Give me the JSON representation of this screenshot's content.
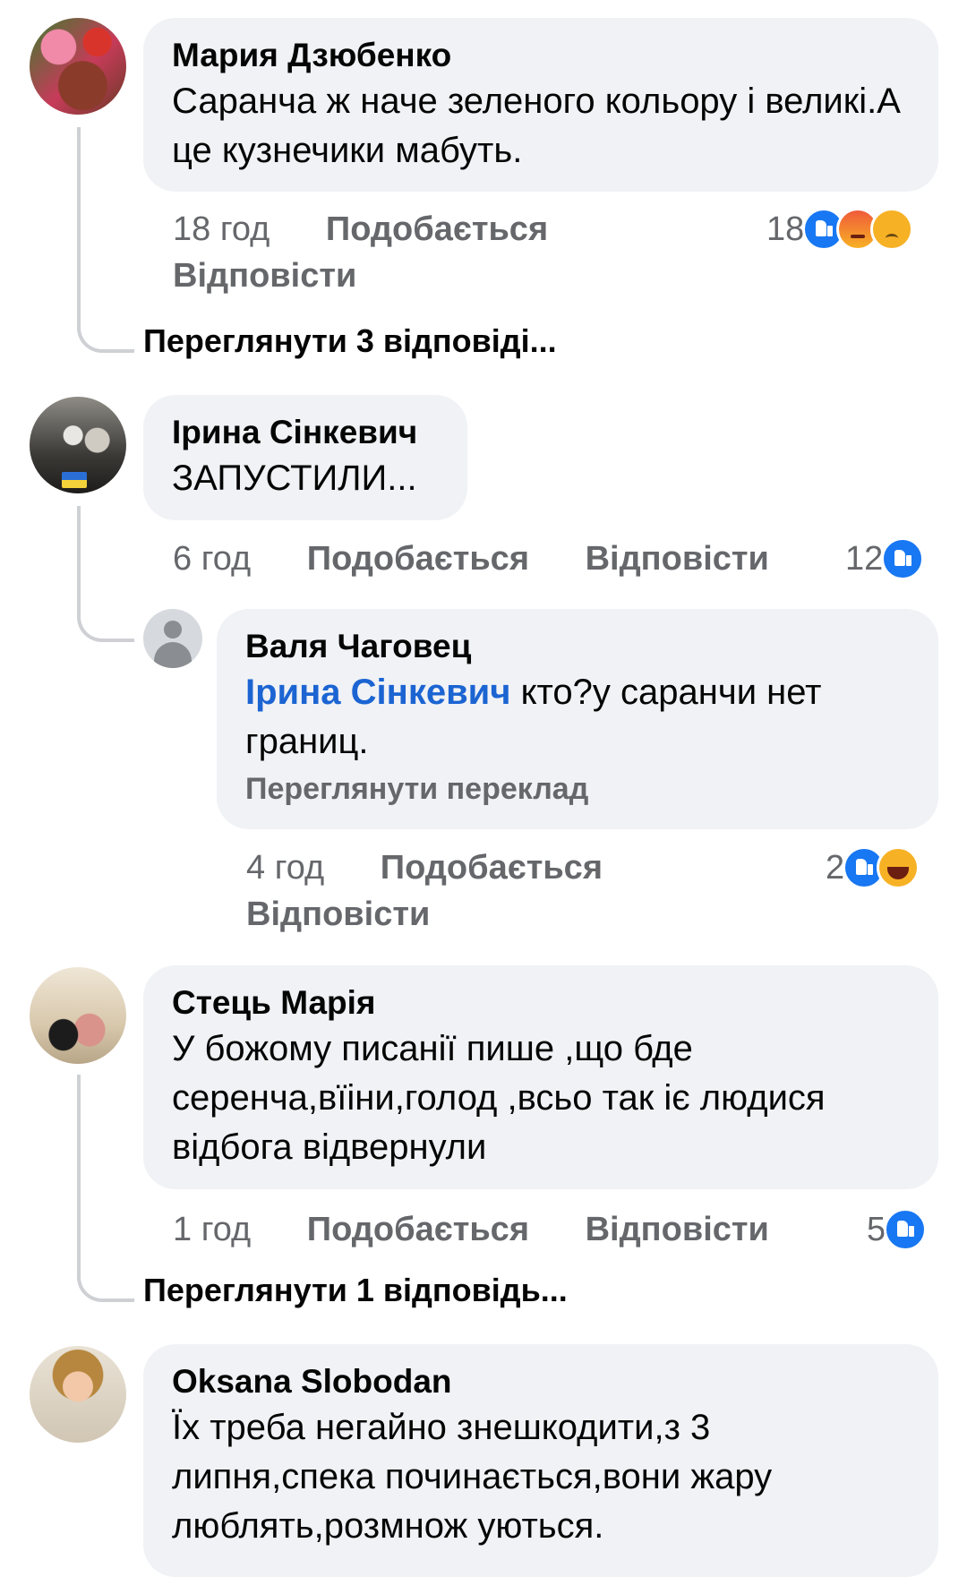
{
  "comments": [
    {
      "author": "Мария Дзюбенко",
      "text": "Саранча ж наче зеленого кольору і великі.А це кузнечики мабуть.",
      "time": "18 год",
      "like": "Подобається",
      "reply": "Відповісти",
      "reactions_count": "18",
      "reactions": [
        "like-icon",
        "angry-icon",
        "sad-icon"
      ],
      "more_replies": "Переглянути 3 відповіді..."
    },
    {
      "author": "Ірина Сінкевич",
      "text": "ЗАПУСТИЛИ...",
      "time": "6 год",
      "like": "Подобається",
      "reply": "Відповісти",
      "reactions_count": "12",
      "reactions": [
        "like-icon"
      ],
      "reply_comment": {
        "author": "Валя Чаговец",
        "mention": "Ірина Сінкевич",
        "text": " кто?у саранчи нет границ.",
        "translate": "Переглянути переклад",
        "time": "4 год",
        "like": "Подобається",
        "reply": "Відповісти",
        "reactions_count": "2",
        "reactions": [
          "like-icon",
          "haha-icon"
        ]
      }
    },
    {
      "author": "Стець Марія",
      "text": "У божому писанії пише ,що бде серенча,вїіни,голод ,всьо так іє людися відбога відвернули",
      "time": "1 год",
      "like": "Подобається",
      "reply": "Відповісти",
      "reactions_count": "5",
      "reactions": [
        "like-icon"
      ],
      "more_replies": "Переглянути 1 відповідь..."
    },
    {
      "author": "Oksana Slobodan",
      "text": "Їх треба негайно знешкодити,з 3 липня,спека починається,вони жару люблять,розмнож уються."
    }
  ],
  "colors": {
    "bubble": "#f0f2f5",
    "mention": "#1b64d2",
    "meta": "#65676b",
    "like": "#1877f2"
  }
}
